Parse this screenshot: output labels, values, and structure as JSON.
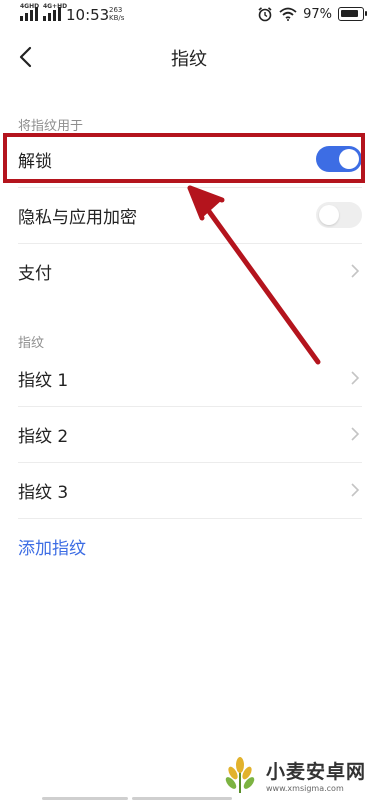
{
  "status_bar": {
    "net1": "4GHD",
    "net2": "4G+HD",
    "time": "10:53",
    "speed_value": "263",
    "speed_unit": "KB/s",
    "battery_pct": "97%"
  },
  "nav": {
    "title": "指纹"
  },
  "usage_section": {
    "header": "将指纹用于",
    "items": [
      {
        "label": "解锁",
        "toggle": "on"
      },
      {
        "label": "隐私与应用加密",
        "toggle": "off"
      },
      {
        "label": "支付"
      }
    ]
  },
  "fingerprint_section": {
    "header": "指纹",
    "items": [
      {
        "label": "指纹 1"
      },
      {
        "label": "指纹 2"
      },
      {
        "label": "指纹 3"
      }
    ],
    "add_label": "添加指纹"
  },
  "annotation": {
    "highlight_color": "#b4141d"
  },
  "watermark": {
    "title": "小麦安卓网",
    "url": "www.xmsigma.com"
  },
  "colors": {
    "accent": "#3d6de4"
  }
}
